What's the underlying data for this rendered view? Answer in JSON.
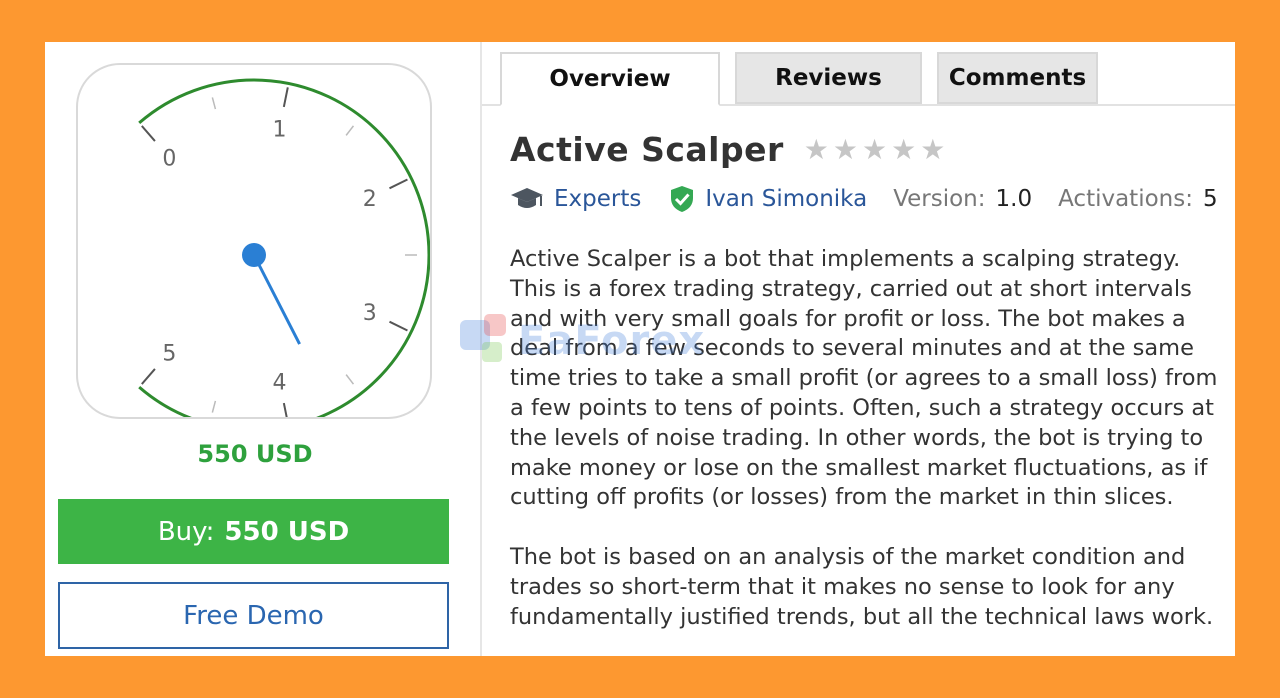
{
  "product": {
    "gauge": {
      "labels": [
        "0",
        "1",
        "2",
        "3",
        "4",
        "5"
      ],
      "needle_value": 3.7,
      "min": 0,
      "max": 5
    },
    "price": "550 USD",
    "buy_prefix": "Buy:",
    "buy_amount": "550 USD",
    "demo_label": "Free Demo"
  },
  "tabs": [
    {
      "label": "Overview",
      "active": true
    },
    {
      "label": "Reviews",
      "active": false
    },
    {
      "label": "Comments",
      "active": false
    }
  ],
  "header": {
    "title": "Active Scalper",
    "rating_stars": 5,
    "category": "Experts",
    "author": "Ivan Simonika",
    "version_label": "Version:",
    "version": "1.0",
    "activations_label": "Activations:",
    "activations": "5"
  },
  "description": {
    "p1": "Active Scalper is a bot that implements a scalping strategy. This is a forex trading strategy, carried out at short intervals and with very small goals for profit or loss. The bot makes a deal from a few seconds to several minutes and at the same time tries to take a small profit (or agrees to a small loss) from a few points to tens of points. Often, such a strategy occurs at the levels of noise trading. In other words, the bot is trying to make money or lose on the smallest market fluctuations, as if cutting off profits (or losses) from the market in thin slices.",
    "p2": "The bot is based on an analysis of the market condition and trades so short-term that it makes no sense to look for any fundamentally justified trends, but all the technical laws work."
  },
  "watermark": "EaForex",
  "colors": {
    "background": "#fd9830",
    "price": "#2ea13d",
    "buy": "#3db446",
    "link": "#2a5699",
    "gauge_arc": "#2e8b2e",
    "needle": "#2a7fd4"
  }
}
